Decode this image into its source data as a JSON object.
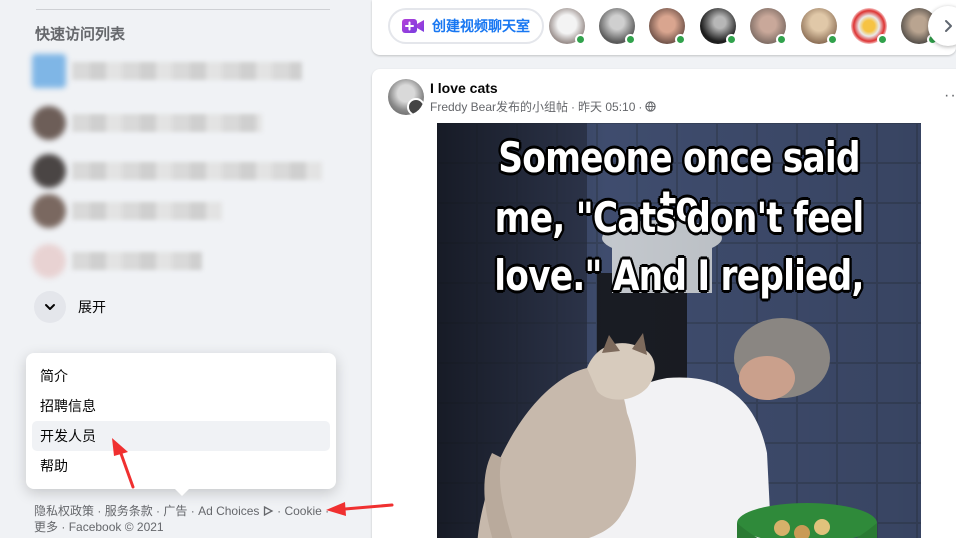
{
  "shortcuts": {
    "title": "快速访问列表",
    "expand_label": "展开"
  },
  "popup_menu": {
    "items": [
      {
        "label": "简介"
      },
      {
        "label": "招聘信息"
      },
      {
        "label": "开发人员"
      },
      {
        "label": "帮助"
      }
    ]
  },
  "footer": {
    "privacy": "隐私权政策",
    "terms": "服务条款",
    "ads": "广告",
    "ad_choices": "Ad Choices",
    "cookie": "Cookie",
    "more": "更多",
    "copyright": "Facebook © 2021",
    "separator": " · "
  },
  "rooms": {
    "create_label": "创建视频聊天室",
    "avatar_count": 8
  },
  "post": {
    "title": "I love cats",
    "group": "Freddy Bear发布的小组帖",
    "separator": "·",
    "time": "昨天 05:10",
    "more_label": "···",
    "meme_lines": [
      "Someone once said to",
      "me, \"Cats don't feel",
      "love.\" And I replied,"
    ]
  },
  "colors": {
    "accent": "#1877f2",
    "online": "#31a24c",
    "annotation_arrow": "#f03030"
  }
}
